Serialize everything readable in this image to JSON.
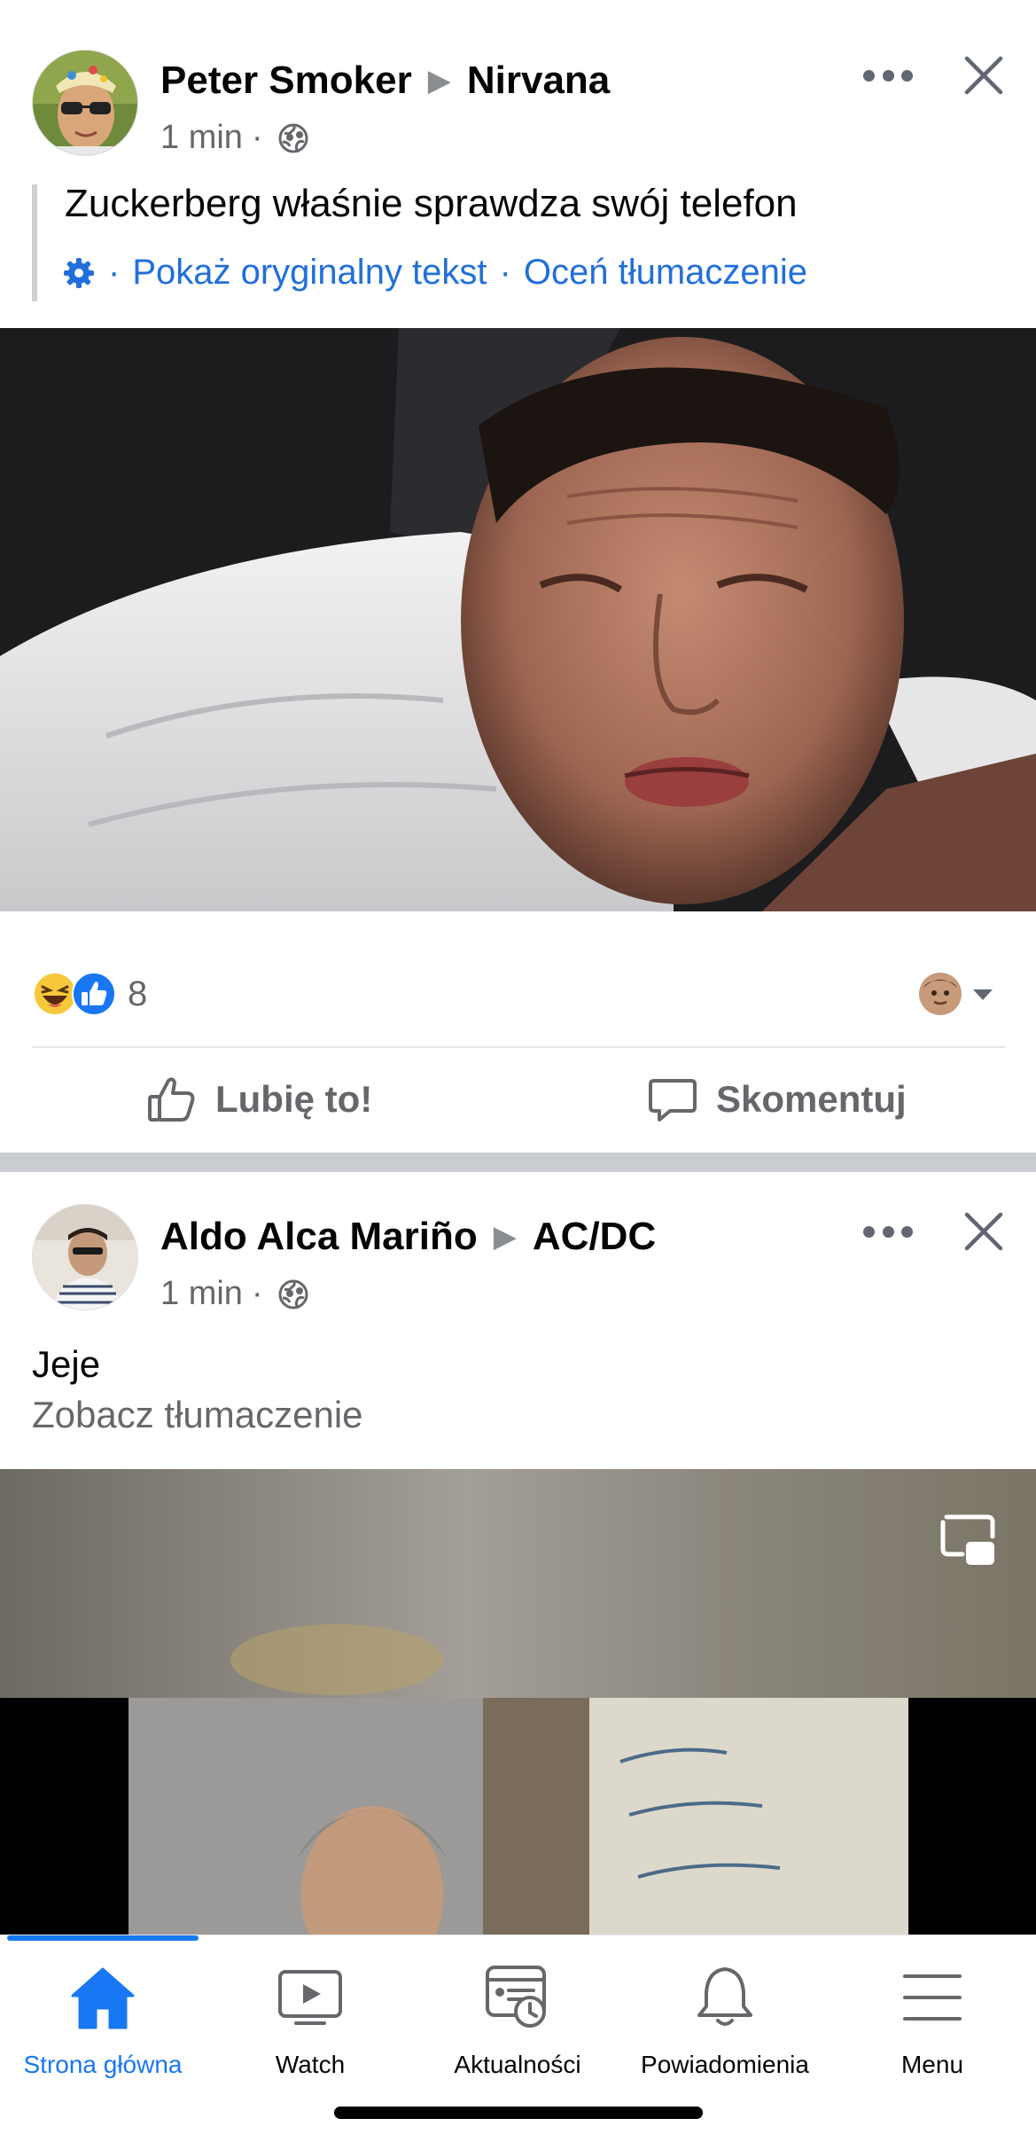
{
  "posts": [
    {
      "author": "Peter Smoker",
      "group": "Nirvana",
      "time": "1 min",
      "meta_dot": "·",
      "text": "Zuckerberg właśnie sprawdza swój telefon",
      "translation": {
        "sep": "·",
        "show_original": "Pokaż oryginalny tekst",
        "rate": "Oceń tłumaczenie"
      },
      "reaction_count": "8",
      "reactions": [
        "haha-icon",
        "like-icon"
      ],
      "actions": {
        "like": "Lubię to!",
        "comment": "Skomentuj"
      }
    },
    {
      "author": "Aldo Alca Mariño",
      "group": "AC/DC",
      "time": "1 min",
      "meta_dot": "·",
      "text": "Jeje",
      "see_translation": "Zobacz tłumaczenie"
    }
  ],
  "tabbar": {
    "tabs": [
      {
        "label": "Strona główna",
        "icon": "home-icon",
        "active": true
      },
      {
        "label": "Watch",
        "icon": "watch-icon",
        "active": false
      },
      {
        "label": "Aktualności",
        "icon": "news-feed-icon",
        "active": false
      },
      {
        "label": "Powiadomienia",
        "icon": "bell-icon",
        "active": false
      },
      {
        "label": "Menu",
        "icon": "hamburger-menu-icon",
        "active": false
      }
    ]
  },
  "colors": {
    "accent": "#1877f2",
    "link": "#216fdb",
    "secondary_text": "#65676b",
    "separator": "#c9ccd1"
  }
}
